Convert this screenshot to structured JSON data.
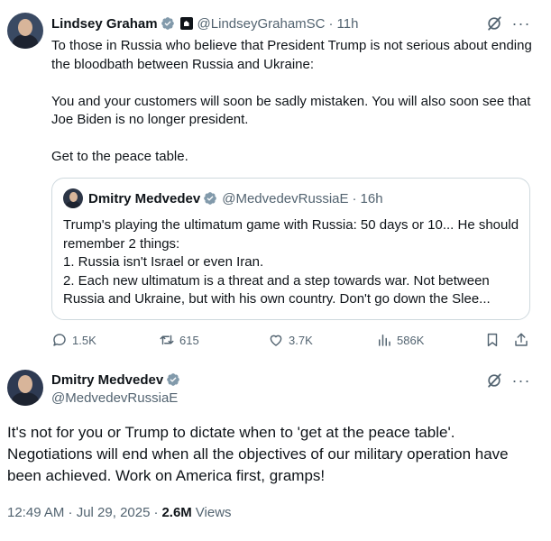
{
  "colors": {
    "text": "#0f1419",
    "secondary": "#536471",
    "verified": "#829aab",
    "border": "#cfd9de"
  },
  "tweet": {
    "author_name": "Lindsey Graham",
    "author_handle": "@LindseyGrahamSC",
    "time": "11h",
    "badges": [
      "verified-icon",
      "government-badge-icon"
    ],
    "paragraphs": [
      "To those in Russia who believe that President Trump is not serious about ending the bloodbath between Russia and Ukraine:",
      "You and your customers will soon be sadly mistaken. You will also soon see that Joe Biden is no longer president.",
      "Get to the peace table."
    ],
    "quote": {
      "author_name": "Dmitry Medvedev",
      "author_handle": "@MedvedevRussiaE",
      "time": "16h",
      "lines": [
        "Trump's playing the ultimatum game with Russia: 50 days or 10... He should remember 2 things:",
        "1. Russia isn't Israel or even Iran.",
        "2. Each new ultimatum is a threat and a step towards war. Not between Russia and Ukraine, but with his own country. Don't go down the Slee..."
      ]
    },
    "actions": {
      "replies": "1.5K",
      "reposts": "615",
      "likes": "3.7K",
      "views": "586K"
    }
  },
  "reply": {
    "author_name": "Dmitry Medvedev",
    "author_handle": "@MedvedevRussiaE",
    "text": "It's not for you or Trump to dictate when to 'get at the peace table'. Negotiations will end when all the objectives of our military operation have been achieved. Work on America first, gramps!",
    "timestamp": "12:49 AM · Jul 29, 2025",
    "views_count": "2.6M",
    "views_label": "Views"
  }
}
